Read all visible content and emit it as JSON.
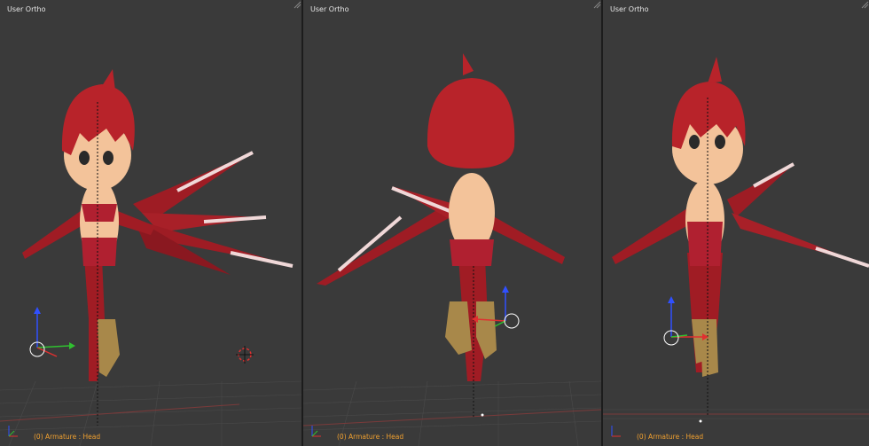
{
  "viewports": [
    {
      "title": "User Ortho",
      "status": "(0) Armature : Head"
    },
    {
      "title": "User Ortho",
      "status": "(0) Armature : Head"
    },
    {
      "title": "User Ortho",
      "status": "(0) Armature : Head"
    }
  ],
  "colors": {
    "background": "#3a3a3a",
    "title_text": "#e6e6e6",
    "status_text": "#f0a030",
    "axis_x": "#e03030",
    "axis_y": "#30c030",
    "axis_z": "#3050ff",
    "hair": "#b8232a",
    "skin": "#f3c39a",
    "boots": "#a8884a"
  },
  "icons": [
    "corner-split-widget",
    "transform-gizmo",
    "3d-cursor",
    "axis-indicator"
  ]
}
